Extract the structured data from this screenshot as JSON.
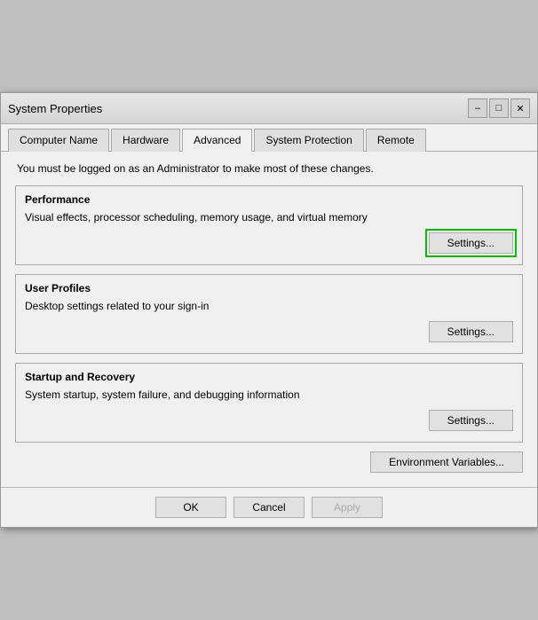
{
  "window": {
    "title": "System Properties"
  },
  "tabs": [
    {
      "label": "Computer Name",
      "active": false
    },
    {
      "label": "Hardware",
      "active": false
    },
    {
      "label": "Advanced",
      "active": true
    },
    {
      "label": "System Protection",
      "active": false
    },
    {
      "label": "Remote",
      "active": false
    }
  ],
  "admin_notice": "You must be logged on as an Administrator to make most of these changes.",
  "performance": {
    "title": "Performance",
    "description": "Visual effects, processor scheduling, memory usage, and virtual memory",
    "settings_label": "Settings..."
  },
  "user_profiles": {
    "title": "User Profiles",
    "description": "Desktop settings related to your sign-in",
    "settings_label": "Settings..."
  },
  "startup_recovery": {
    "title": "Startup and Recovery",
    "description": "System startup, system failure, and debugging information",
    "settings_label": "Settings..."
  },
  "env_variables": {
    "label": "Environment Variables..."
  },
  "footer": {
    "ok_label": "OK",
    "cancel_label": "Cancel",
    "apply_label": "Apply"
  },
  "title_bar": {
    "minimize": "–",
    "maximize": "□",
    "close": "✕"
  }
}
